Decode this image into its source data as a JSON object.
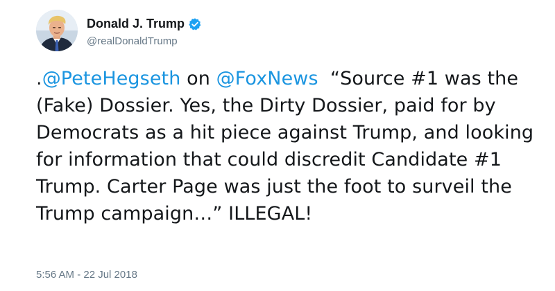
{
  "author": {
    "display_name": "Donald J. Trump",
    "handle": "@realDonaldTrump",
    "verified": true
  },
  "avatar": {
    "icon": "profile-photo"
  },
  "verified_badge": {
    "icon": "verified-checkmark-icon",
    "color": "#1da1f2"
  },
  "tweet": {
    "text_prefix": ".",
    "mention_1": "@PeteHegseth",
    "text_between": " on ",
    "mention_2": "@FoxNews",
    "body_text": "  “Source #1 was the (Fake) Dossier. Yes, the Dirty Dossier, paid for by Democrats as a hit piece against Trump, and looking for information that could discredit Candidate #1 Trump. Carter Page was just the foot to surveil the Trump campaign…” ILLEGAL!",
    "timestamp": "5:56 AM - 22 Jul 2018"
  },
  "colors": {
    "link": "#1b95e0",
    "text": "#14171a",
    "secondary": "#657786"
  }
}
